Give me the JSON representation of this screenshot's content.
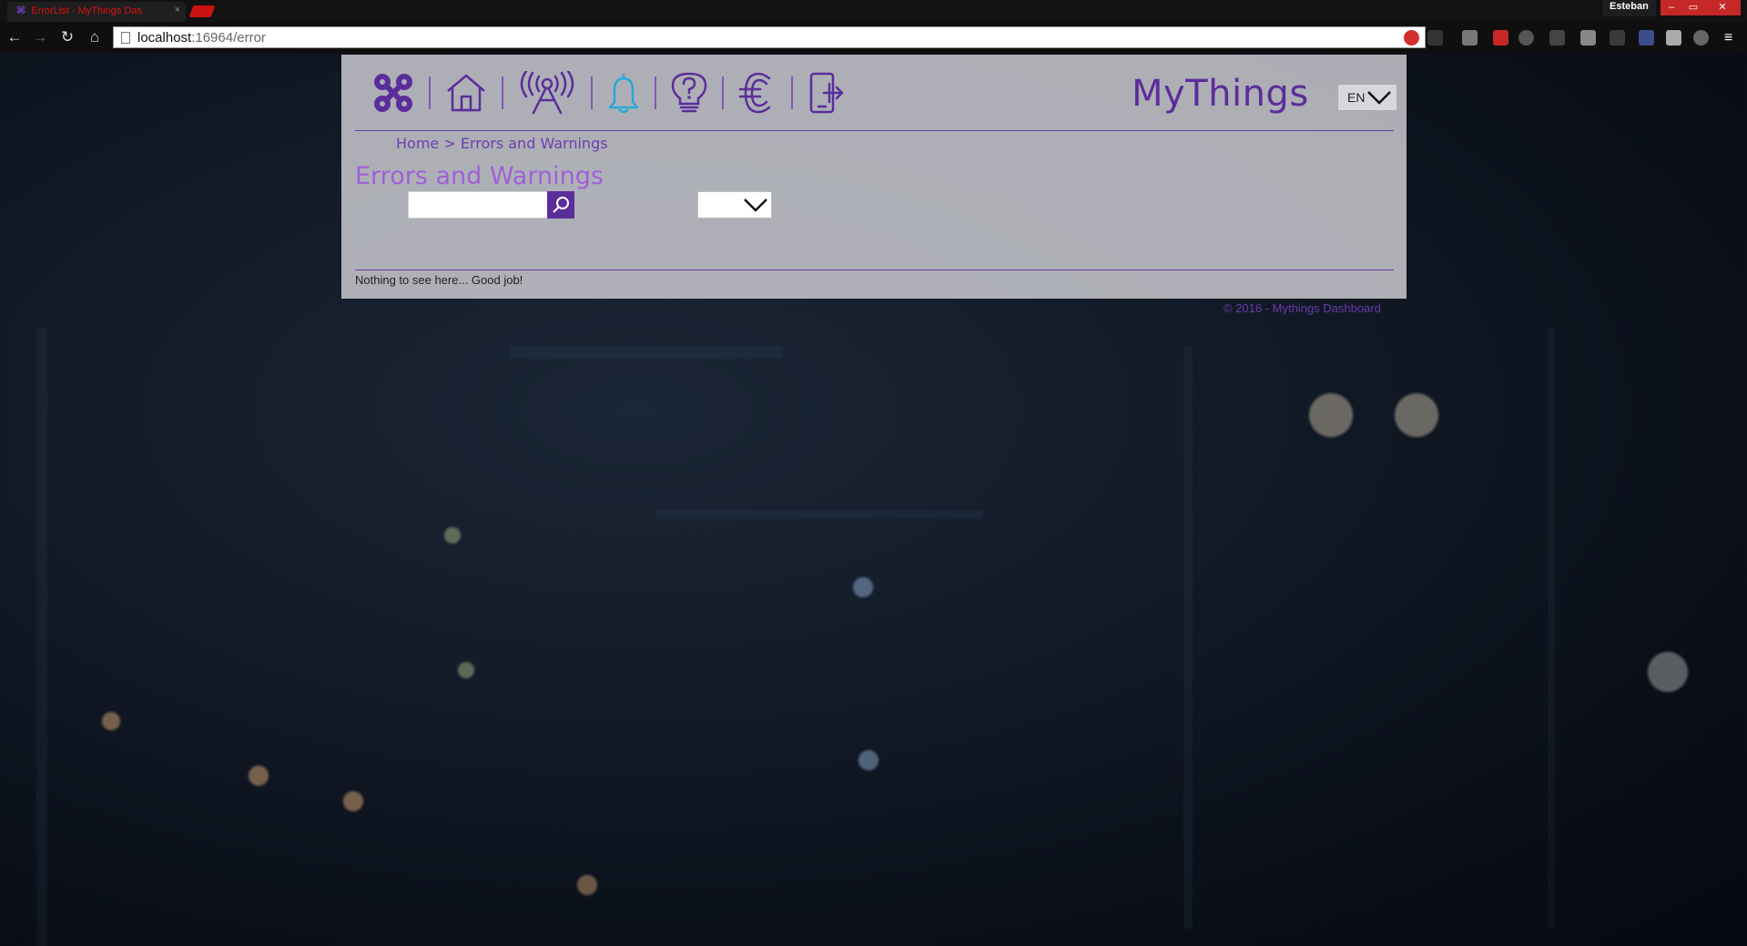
{
  "browser": {
    "tab_title": "ErrorList - MyThings Das",
    "tab_close": "×",
    "user_name": "Esteban",
    "url_host": "localhost",
    "url_rest": ":16964/error",
    "win_min": "–",
    "win_max": "▭",
    "win_close": "✕"
  },
  "header": {
    "brand": "MyThings",
    "language": "EN",
    "nav_icons": [
      "logo-icon",
      "home-icon",
      "broadcast-icon",
      "bell-icon",
      "lightbulb-help-icon",
      "euro-icon",
      "phone-logout-icon"
    ]
  },
  "breadcrumb": {
    "text": "Home > Errors and Warnings"
  },
  "main": {
    "title": "Errors and Warnings",
    "search_value": "",
    "filter_value": "",
    "empty_message": "Nothing to see here... Good job!"
  },
  "footer": {
    "text": "© 2016 - Mythings Dashboard"
  },
  "colors": {
    "primary": "#5b2d9b",
    "title": "#a060d8",
    "accent_bell": "#29a8d8"
  }
}
